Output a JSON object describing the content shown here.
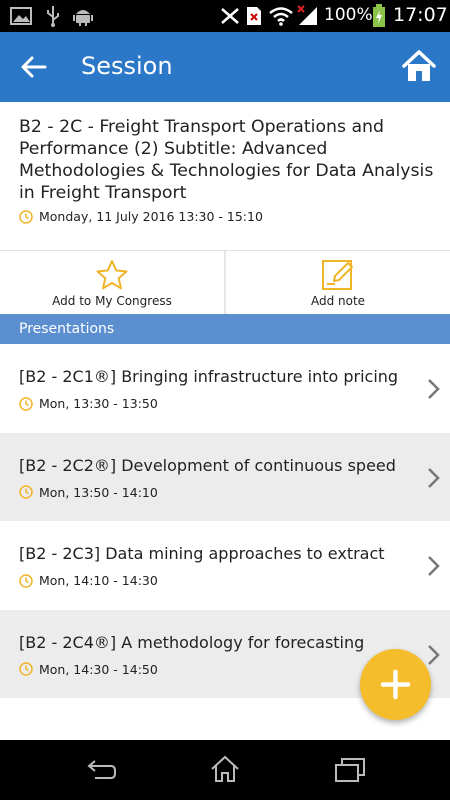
{
  "status_bar": {
    "battery_percent": "100%",
    "time": "17:07",
    "left_icons": [
      "image-icon",
      "usb-icon",
      "android-icon"
    ],
    "right_icons": [
      "mute-icon",
      "sim-icon",
      "wifi-icon",
      "signal-icon",
      "battery-icon"
    ]
  },
  "app_bar": {
    "title": "Session",
    "accent_color": "#2c78c8"
  },
  "session": {
    "title": "B2 - 2C - Freight Transport Operations and Performance (2) Subtitle: Advanced Methodologies & Technologies for Data Analysis in Freight Transport",
    "datetime": "Monday, 11 July 2016 13:30 - 15:10"
  },
  "actions": {
    "add_to_congress": "Add to My Congress",
    "add_note": "Add note"
  },
  "presentations": {
    "header": "Presentations",
    "items": [
      {
        "title": "[B2 - 2C1®] Bringing infrastructure into pricing",
        "time": "Mon, 13:30 - 13:50"
      },
      {
        "title": "[B2 - 2C2®] Development of continuous speed",
        "time": "Mon, 13:50 - 14:10"
      },
      {
        "title": "[B2 - 2C3] Data mining approaches to extract",
        "time": "Mon, 14:10 - 14:30"
      },
      {
        "title": "[B2 - 2C4®] A methodology for forecasting",
        "time": "Mon, 14:30 - 14:50"
      }
    ]
  },
  "fab": {
    "icon": "plus-icon",
    "color": "#f5bd2c"
  },
  "nav_bar": {
    "icons": [
      "back-nav-icon",
      "home-nav-icon",
      "recents-nav-icon"
    ]
  }
}
